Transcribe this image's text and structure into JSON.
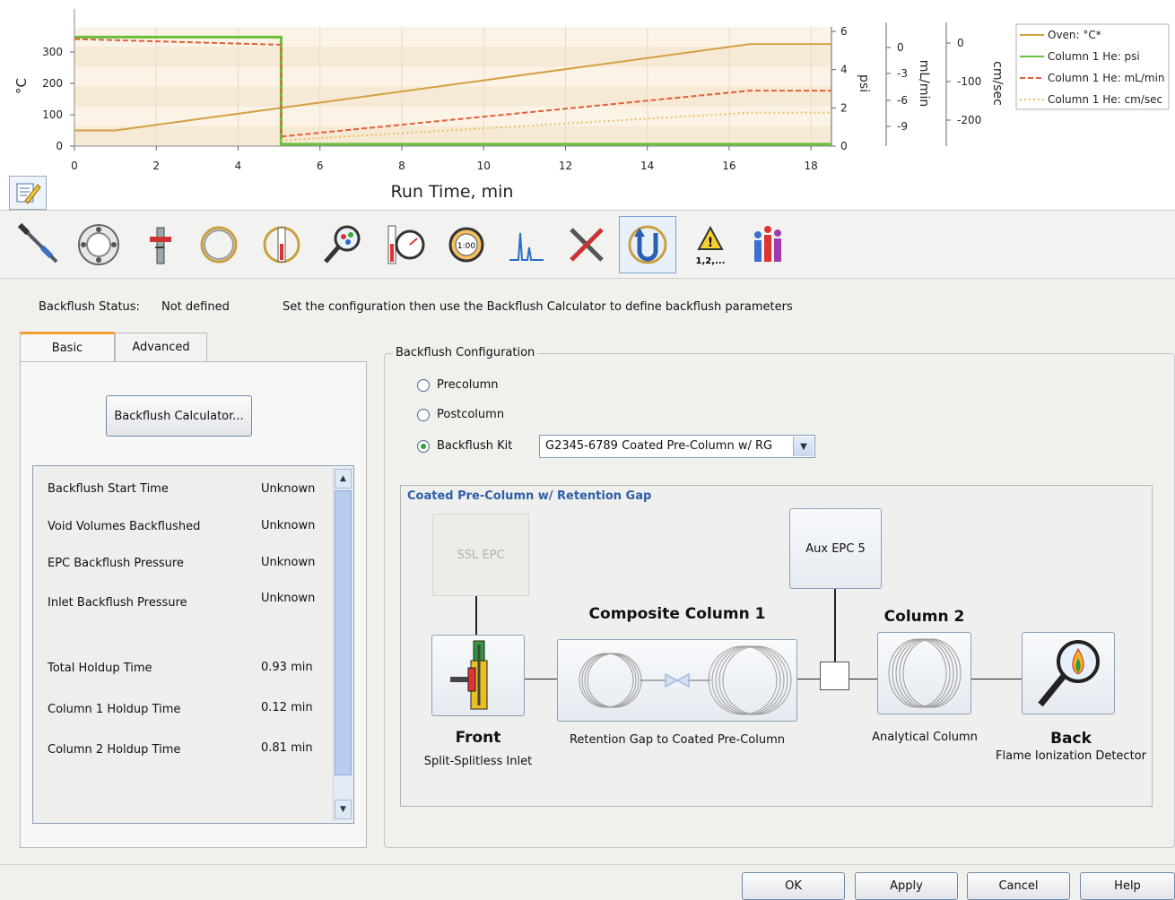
{
  "chart_data": {
    "type": "line",
    "x": [
      0,
      1,
      5,
      5.05,
      16.5,
      18.5
    ],
    "xlabel": "Run Time, min",
    "xlim": [
      0,
      18.5
    ],
    "xticks": [
      0,
      2,
      4,
      6,
      8,
      10,
      12,
      14,
      16,
      18
    ],
    "axes": {
      "left": {
        "label": "°C",
        "ticks": [
          0,
          100,
          200,
          300
        ],
        "range": [
          0,
          380
        ]
      },
      "psi": {
        "label": "psi",
        "ticks": [
          0,
          2,
          4,
          6
        ],
        "range": [
          0,
          6
        ]
      },
      "mlmin": {
        "label": "mL/min",
        "ticks": [
          0,
          -3,
          -6,
          -9
        ]
      },
      "cmsec": {
        "label": "cm/sec",
        "ticks": [
          0,
          -100,
          -200
        ]
      }
    },
    "series": [
      {
        "name": "Oven: °C*",
        "color": "#d4a040",
        "style": "solid",
        "x": [
          0,
          1,
          16.5,
          18.5
        ],
        "y": [
          50,
          50,
          325,
          325
        ]
      },
      {
        "name": "Column 1 He: psi",
        "color": "#6abf3a",
        "style": "solid",
        "x": [
          0,
          5.05,
          5.05,
          18.5
        ],
        "y": [
          5.7,
          5.7,
          0.1,
          0.1
        ]
      },
      {
        "name": "Column 1 He: mL/min",
        "color": "#e0603a",
        "style": "dashed",
        "x": [
          0,
          5.05,
          5.05,
          16.5,
          18.5
        ],
        "y": [
          5.6,
          5.3,
          0.5,
          2.9,
          2.9
        ]
      },
      {
        "name": "Column 1 He: cm/sec",
        "color": "#e8c060",
        "style": "dotted",
        "x": [
          5.05,
          16.5,
          18.5
        ],
        "y": [
          0.3,
          1.75,
          1.75
        ]
      }
    ]
  },
  "toolbar": {
    "icons": [
      "injector-icon",
      "sampler-tray-icon",
      "valve-icon",
      "column-icon",
      "oven-icon",
      "detector-icon",
      "aux-pressure-icon",
      "runtime-icon",
      "signal-icon",
      "configuration-icon",
      "backflush-icon",
      "events-icon",
      "status-icon"
    ],
    "events_label": "1,2,..."
  },
  "status": {
    "label": "Backflush Status:",
    "value": "Not defined",
    "hint": "Set the configuration then use the Backflush Calculator to define backflush parameters"
  },
  "tabs": {
    "basic": "Basic",
    "advanced": "Advanced"
  },
  "calculator_button": "Backflush Calculator...",
  "results": [
    {
      "label": "Backflush Start Time",
      "value": "Unknown"
    },
    {
      "label": "Void Volumes Backflushed",
      "value": "Unknown"
    },
    {
      "label": "EPC Backflush Pressure",
      "value": "Unknown"
    },
    {
      "label": "Inlet Backflush Pressure",
      "value": "Unknown"
    },
    {
      "label": "Total Holdup Time",
      "value": "0.93 min"
    },
    {
      "label": "Column 1 Holdup Time",
      "value": "0.12 min"
    },
    {
      "label": "Column 2 Holdup Time",
      "value": "0.81 min"
    }
  ],
  "config": {
    "title": "Backflush Configuration",
    "options": [
      "Precolumn",
      "Postcolumn",
      "Backflush Kit"
    ],
    "selected": "Backflush Kit",
    "kit_value": "G2345-6789 Coated Pre-Column w/ RG"
  },
  "diagram": {
    "title": "Coated Pre-Column w/ Retention Gap",
    "ssl_epc": "SSL EPC",
    "aux_epc": "Aux EPC 5",
    "composite_title": "Composite Column 1",
    "composite_caption": "Retention Gap to Coated Pre-Column",
    "column2_title": "Column 2",
    "column2_caption": "Analytical Column",
    "front_title": "Front",
    "front_caption": "Split-Splitless Inlet",
    "back_title": "Back",
    "back_caption": "Flame Ionization Detector"
  },
  "buttons": {
    "ok": "OK",
    "apply": "Apply",
    "cancel": "Cancel",
    "help": "Help"
  }
}
